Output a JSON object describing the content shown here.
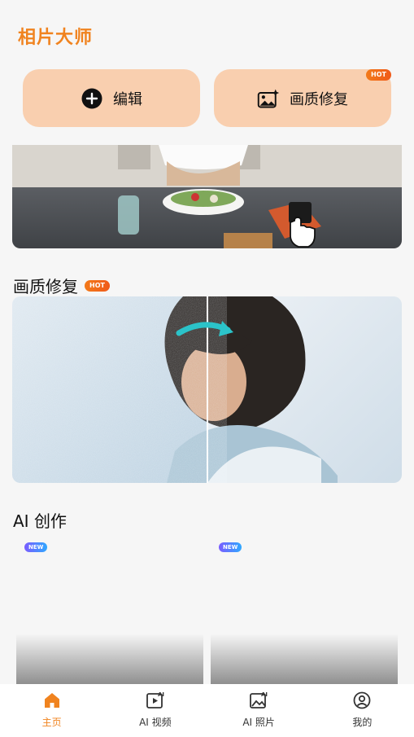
{
  "app": {
    "title": "相片大师"
  },
  "actions": [
    {
      "label": "编辑",
      "icon": "plus-circle-icon"
    },
    {
      "label": "画质修复",
      "icon": "image-sparkle-icon",
      "badge": "HOT"
    }
  ],
  "sections": {
    "enhance": {
      "title": "画质修复",
      "badge": "HOT"
    },
    "ai_create": {
      "title": "AI 创作",
      "cards": [
        {
          "badge": "NEW"
        },
        {
          "badge": "NEW"
        }
      ]
    }
  },
  "tabs": [
    {
      "label": "主页",
      "icon": "home-icon",
      "active": true
    },
    {
      "label": "AI 视频",
      "icon": "ai-video-icon",
      "active": false
    },
    {
      "label": "AI 照片",
      "icon": "ai-photo-icon",
      "active": false
    },
    {
      "label": "我的",
      "icon": "profile-icon",
      "active": false
    }
  ],
  "colors": {
    "accent": "#f0831f",
    "button_bg": "#f9cfaf",
    "hot": "#f05a1a"
  }
}
